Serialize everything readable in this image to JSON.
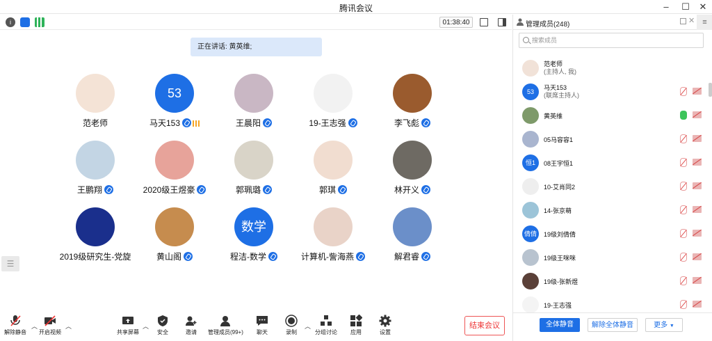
{
  "window": {
    "title": "腾讯会议"
  },
  "topbar": {
    "timer": "01:38:40"
  },
  "stage": {
    "speaking": "正在讲话: 黄英维;",
    "tiles": [
      {
        "name": "范老师",
        "avatar_text": "",
        "avatar_color": "#f4e3d6",
        "mic": false,
        "signal": false
      },
      {
        "name": "马天153",
        "avatar_text": "53",
        "avatar_color": "#1e6fe5",
        "mic": true,
        "signal": true
      },
      {
        "name": "王晨阳",
        "avatar_text": "",
        "avatar_color": "#c9b7c4",
        "mic": true,
        "signal": false
      },
      {
        "name": "19-王志强",
        "avatar_text": "",
        "avatar_color": "#f2f2f2",
        "mic": true,
        "signal": false
      },
      {
        "name": "李飞彪",
        "avatar_text": "",
        "avatar_color": "#9a5b2e",
        "mic": true,
        "signal": false
      },
      {
        "name": "王鹏翔",
        "avatar_text": "",
        "avatar_color": "#c3d5e4",
        "mic": true,
        "signal": false
      },
      {
        "name": "2020级王煜豪",
        "avatar_text": "",
        "avatar_color": "#e7a39a",
        "mic": true,
        "signal": false
      },
      {
        "name": "郭珮璐",
        "avatar_text": "",
        "avatar_color": "#d9d4c8",
        "mic": true,
        "signal": false
      },
      {
        "name": "郭琪",
        "avatar_text": "",
        "avatar_color": "#f1ddd0",
        "mic": true,
        "signal": false
      },
      {
        "name": "林开义",
        "avatar_text": "",
        "avatar_color": "#6e6a63",
        "mic": true,
        "signal": false
      },
      {
        "name": "2019级研究生-党旋",
        "avatar_text": "",
        "avatar_color": "#1a2f8c",
        "mic": false,
        "signal": false
      },
      {
        "name": "黄山阁",
        "avatar_text": "",
        "avatar_color": "#c68c4e",
        "mic": true,
        "signal": false
      },
      {
        "name": "程洁-数学",
        "avatar_text": "数学",
        "avatar_color": "#1e6fe5",
        "mic": true,
        "signal": false
      },
      {
        "name": "计算机-訾海燕",
        "avatar_text": "",
        "avatar_color": "#e9d3c8",
        "mic": true,
        "signal": false
      },
      {
        "name": "解君睿",
        "avatar_text": "",
        "avatar_color": "#6b8fc9",
        "mic": true,
        "signal": false
      }
    ]
  },
  "toolbar": {
    "unmute": "解除静音",
    "start_video": "开启视频",
    "share_screen": "共享屏幕",
    "security": "安全",
    "invite": "邀请",
    "manage_members": "管理成员(99+)",
    "chat": "聊天",
    "record": "录制",
    "breakout": "分组讨论",
    "apps": "应用",
    "settings": "设置",
    "end_meeting": "结束会议"
  },
  "panel": {
    "title": "管理成员(248)",
    "search_placeholder": "搜索成员",
    "members": [
      {
        "name": "范老师",
        "sub": "(主持人, 我)",
        "avatar_text": "",
        "avatar_color": "#f1e2d8",
        "mic": "none",
        "cam": "none"
      },
      {
        "name": "马天153",
        "sub": "(联席主持人)",
        "avatar_text": "53",
        "avatar_color": "#1e6fe5",
        "mic": "muted",
        "cam": "off"
      },
      {
        "name": "黄英维",
        "sub": "",
        "avatar_text": "",
        "avatar_color": "#7e9a6a",
        "mic": "live",
        "cam": "off"
      },
      {
        "name": "05马容容1",
        "sub": "",
        "avatar_text": "",
        "avatar_color": "#a9b5cf",
        "mic": "muted",
        "cam": "off"
      },
      {
        "name": "08王宇恒1",
        "sub": "",
        "avatar_text": "恒1",
        "avatar_color": "#1e6fe5",
        "mic": "muted",
        "cam": "off"
      },
      {
        "name": "10-艾肖同2",
        "sub": "",
        "avatar_text": "",
        "avatar_color": "#eeeeee",
        "mic": "muted",
        "cam": "off"
      },
      {
        "name": "14-张京萌",
        "sub": "",
        "avatar_text": "",
        "avatar_color": "#9cc4d8",
        "mic": "muted",
        "cam": "off"
      },
      {
        "name": "19级刘倩倩",
        "sub": "",
        "avatar_text": "倩倩",
        "avatar_color": "#1e6fe5",
        "mic": "muted",
        "cam": "off"
      },
      {
        "name": "19级王咪咪",
        "sub": "",
        "avatar_text": "",
        "avatar_color": "#b8c3cf",
        "mic": "muted",
        "cam": "off"
      },
      {
        "name": "19级-张新煜",
        "sub": "",
        "avatar_text": "",
        "avatar_color": "#5a4038",
        "mic": "muted",
        "cam": "off"
      },
      {
        "name": "19-王志强",
        "sub": "",
        "avatar_text": "",
        "avatar_color": "#f4f4f4",
        "mic": "muted",
        "cam": "off"
      }
    ],
    "mute_all": "全体静音",
    "unmute_all": "解除全体静音",
    "more": "更多"
  }
}
